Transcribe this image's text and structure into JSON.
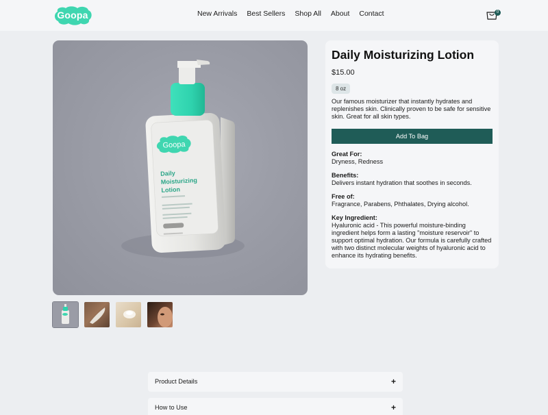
{
  "header": {
    "logo": "Goopa",
    "nav": [
      "New Arrivals",
      "Best Sellers",
      "Shop All",
      "About",
      "Contact"
    ],
    "bag_count": "0"
  },
  "product": {
    "title": "Daily Moisturizing Lotion",
    "price": "$15.00",
    "size": "8 oz",
    "description": "Our famous moisturizer that instantly hydrates and replenishes skin. Clinically proven to be safe for sensitive skin. Great for all skin types.",
    "add_button": "Add To Bag",
    "details": [
      {
        "label": "Great For:",
        "value": "Dryness, Redness"
      },
      {
        "label": "Benefits:",
        "value": "Delivers instant hydration that soothes in seconds."
      },
      {
        "label": "Free of:",
        "value": "Fragrance, Parabens, Phthalates, Drying alcohol."
      },
      {
        "label": "Key Ingredient:",
        "value": "Hyaluronic acid - This powerful moisture-binding ingredient helps form a lasting \"moisture reservoir\" to support optimal hydration. Our formula is carefully crafted with two distinct molecular weights of hyaluronic acid to enhance its hydrating benefits."
      }
    ]
  },
  "bottle_label": {
    "brand": "Goopa",
    "name_line1": "Daily",
    "name_line2": "Moisturizing",
    "name_line3": "Lotion"
  },
  "accordions": [
    {
      "label": "Product Details",
      "icon": "+"
    },
    {
      "label": "How to Use",
      "icon": "+"
    }
  ],
  "colors": {
    "accent": "#1f5c57",
    "logo": "#3fd6b0",
    "pump": "#2fd3ae"
  },
  "icons": {
    "bag": "shopping-bag-icon",
    "expand": "plus-icon"
  }
}
